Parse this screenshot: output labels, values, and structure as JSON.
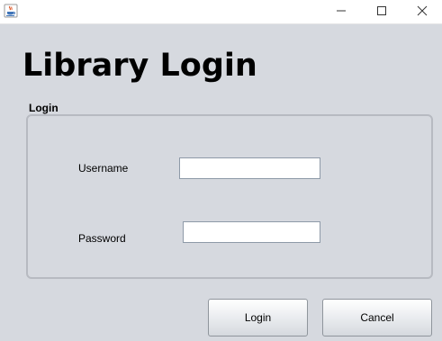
{
  "window": {
    "controls": {
      "minimize_icon": "minimize-icon",
      "maximize_icon": "maximize-icon",
      "close_icon": "close-icon"
    },
    "app_icon": "java-coffee-icon"
  },
  "header": {
    "title": "Library Login"
  },
  "login_group": {
    "title": "Login",
    "username_label": "Username",
    "username_value": "",
    "password_label": "Password",
    "password_value": ""
  },
  "actions": {
    "login_label": "Login",
    "cancel_label": "Cancel"
  },
  "colors": {
    "background": "#d6d9df",
    "titlebar": "#ffffff",
    "group_border": "#b7bac1"
  }
}
